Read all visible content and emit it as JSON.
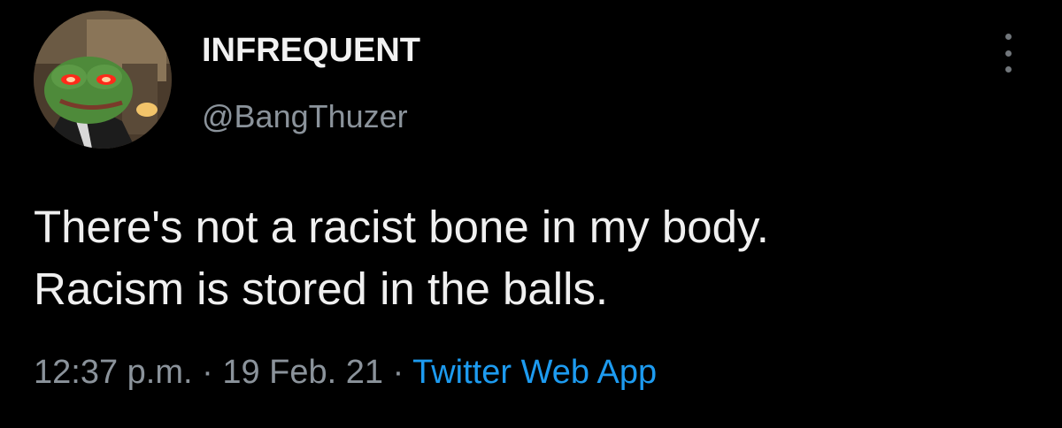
{
  "tweet": {
    "author": {
      "display_name": "INFREQUENT",
      "handle": "@BangThuzer",
      "avatar_icon": "frog-avatar-icon"
    },
    "text_lines": [
      "There's not a racist bone in my body.",
      "Racism is stored in the balls."
    ],
    "time": "12:37 p.m.",
    "separator": " · ",
    "date": "19 Feb. 21",
    "source": "Twitter Web App",
    "more_icon": "more-vertical-icon"
  },
  "colors": {
    "background": "#000000",
    "text": "#f0f0f0",
    "secondary": "#8b939b",
    "link": "#1d9bf0"
  }
}
